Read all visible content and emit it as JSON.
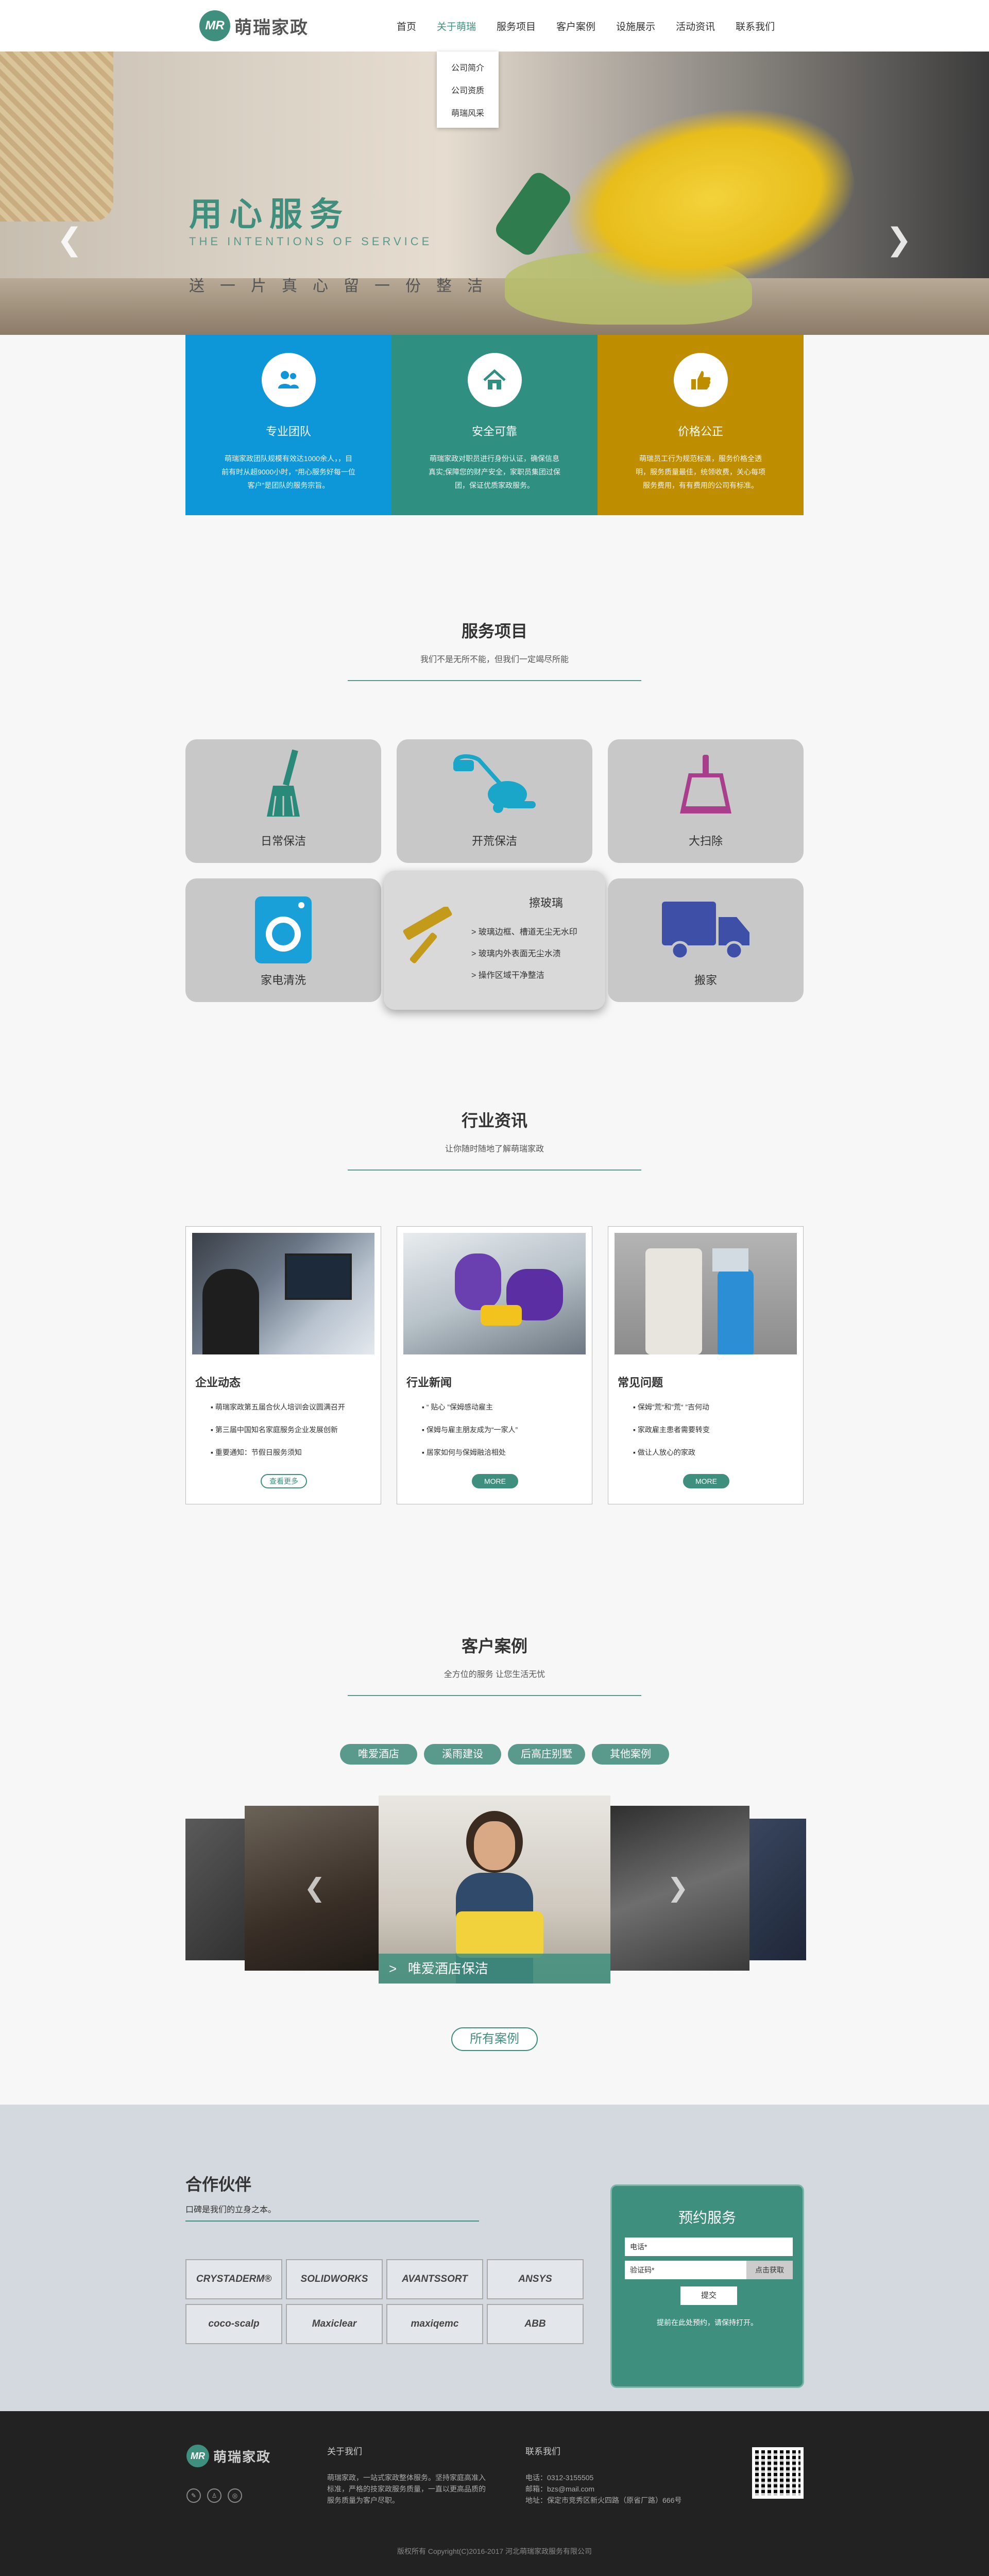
{
  "header": {
    "logo_mark": "MR",
    "logo_text": "萌瑞家政",
    "nav": [
      "首页",
      "关于萌瑞",
      "服务项目",
      "客户案例",
      "设施展示",
      "活动资讯",
      "联系我们"
    ],
    "submenu": [
      "公司简介",
      "公司资质",
      "萌瑞风采"
    ]
  },
  "banner": {
    "title": "用心服务",
    "subtitle": "THE INTENTIONS OF SERVICE",
    "slogan": "送一片真心留一份整洁"
  },
  "features": [
    {
      "title": "专业团队",
      "text": "萌瑞家政团队规模有效达1000余人，，目前有时从超9000小时，“用心服务好每一位客户”是团队的服务宗旨。",
      "color": "#0d97d8",
      "icon": "team-icon"
    },
    {
      "title": "安全可靠",
      "text": "萌瑞家政对职员进行身份认证，确保信息真实;保障您的财产安全，家职员集团过保团，保证优质家政服务。",
      "color": "#2f9082",
      "icon": "home-icon"
    },
    {
      "title": "价格公正",
      "text": "萌瑞员工行为规范标准，服务价格全透明，服务质量最佳，统领收费，关心每项服务费用，有有费用的公司有标准。",
      "color": "#be8d00",
      "icon": "thumb-up-icon"
    }
  ],
  "services_section": {
    "title": "服务项目",
    "subtitle": "我们不是无所不能，但我们一定竭尽所能",
    "items": [
      "日常保洁",
      "开荒保洁",
      "大扫除",
      "家电清洗",
      "擦玻璃",
      "搬家"
    ],
    "popup": {
      "title": "擦玻璃",
      "lines": [
        "玻璃边框、槽道无尘无水印",
        "玻璃内外表面无尘水渍",
        "操作区域干净整洁"
      ]
    }
  },
  "news_section": {
    "title": "行业资讯",
    "subtitle": "让你随时随地了解萌瑞家政",
    "cards": [
      {
        "category": "企业动态",
        "items": [
          "萌瑞家政第五届合伙人培训会议圆满召开",
          "第三届中国知名家庭服务企业发展创新",
          "重要通知：节假日服务须知"
        ],
        "button": "查看更多"
      },
      {
        "category": "行业新闻",
        "items": [
          "“ 贴心 ”保姆感动雇主",
          "保姆与雇主朋友成为“一家人”",
          "居家如何与保姆融洽相处"
        ],
        "button": "MORE"
      },
      {
        "category": "常见问题",
        "items": [
          "保姆”荒“和”荒“ ”吉何动",
          "家政雇主患者需要转变",
          "做让人放心的家政"
        ],
        "button": "MORE"
      }
    ]
  },
  "cases_section": {
    "title": "客户案例",
    "subtitle": "全方位的服务 让您生活无忧",
    "tabs": [
      "唯爱酒店",
      "溪雨建设",
      "后高庄别墅",
      "其他案例"
    ],
    "caption": "唯爱酒店保洁",
    "all_button": "所有案例"
  },
  "partners": {
    "title": "合作伙伴",
    "subtitle": "口碑是我们的立身之本。",
    "logos": [
      "CRYSTADERM®",
      "SOLIDWORKS",
      "AVANTSSORT",
      "ANSYS",
      "coco-scalp",
      "Maxiclear",
      "maxiqemc",
      "ABB"
    ]
  },
  "booking": {
    "title": "预约服务",
    "phone_placeholder": "电话*",
    "code_placeholder": "验证码*",
    "code_button": "点击获取",
    "submit": "提交",
    "note": "提前在此处预约，请保持打开。"
  },
  "footer": {
    "logo_text": "萌瑞家政",
    "about_title": "关于我们",
    "about_text": "萌瑞家政，一站式家政整体服务。坚持家庭高准入标准，严格的技家政服务质量，一直以更高品质的服务质量为客户尽职。",
    "contact_title": "联系我们",
    "phone": "电话：0312-3155505",
    "email": "邮箱：bzs@mail.com",
    "address": "地址：保定市竞秀区新火四路（原省厂路）666号",
    "copyright": "版权所有 Copyright(C)2016-2017 河北萌瑞家政服务有限公司"
  }
}
